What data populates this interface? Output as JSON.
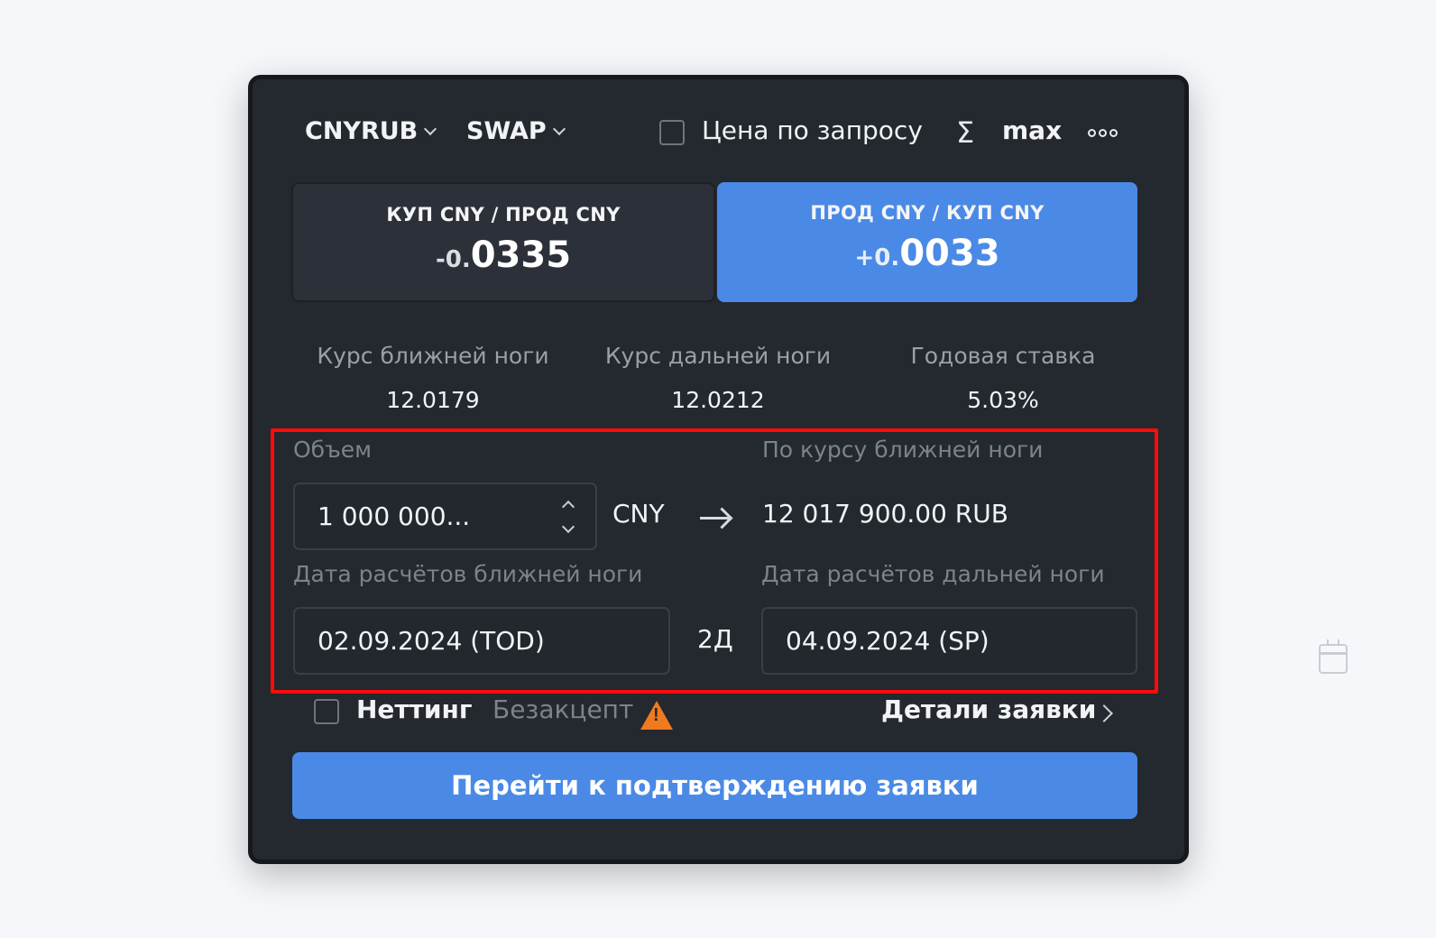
{
  "header": {
    "pair": "CNYRUB",
    "instrument": "SWAP",
    "request_price_label": "Цена по запросу",
    "sum_icon": "sigma-icon",
    "max_label": "max",
    "more_icon": "more-dots-icon"
  },
  "directions": [
    {
      "title": "КУП CNY / ПРОД CNY",
      "value_prefix": "-0.",
      "value_main": "0335",
      "selected": false
    },
    {
      "title": "ПРОД CNY / КУП CNY",
      "value_prefix": "+0.",
      "value_main": "0033",
      "selected": true
    }
  ],
  "rates": [
    {
      "label": "Курс ближней ноги",
      "value": "12.0179"
    },
    {
      "label": "Курс дальней ноги",
      "value": "12.0212"
    },
    {
      "label": "Годовая ставка",
      "value": "5.03%"
    }
  ],
  "volume": {
    "label": "Объем",
    "value": "1 000 000...",
    "currency": "CNY",
    "near_rate_label": "По курсу ближней ноги",
    "converted": "12 017 900.00 RUB"
  },
  "dates": {
    "near_label": "Дата расчётов ближней ноги",
    "near_value": "02.09.2024 (TOD)",
    "tenor": "2Д",
    "far_label": "Дата расчётов дальней ноги",
    "far_value": "04.09.2024 (SP)"
  },
  "footer": {
    "netting_label": "Неттинг",
    "no_accept_label": "Безакцепт",
    "details_label": "Детали заявки",
    "submit_label": "Перейти к подтверждению заявки"
  },
  "colors": {
    "panel_bg": "#24282f",
    "accent_blue": "#4a8ae6",
    "highlight_red": "#ff0b0b",
    "warning_orange": "#f07a1e"
  }
}
